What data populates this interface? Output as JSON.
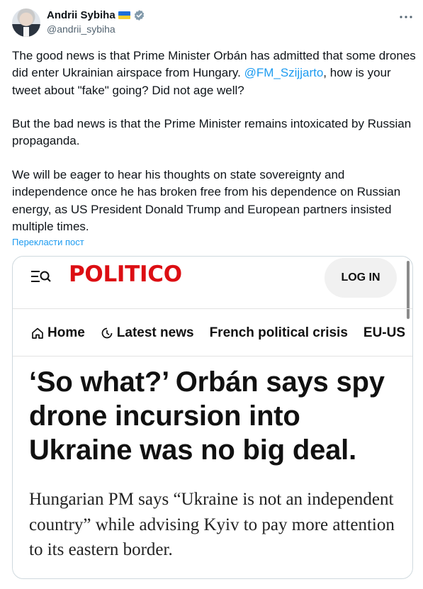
{
  "tweet": {
    "author_name": "Andrii Sybiha",
    "handle": "@andrii_sybiha",
    "paragraph1_before": "The good news is that Prime Minister Orbán has admitted that some drones did enter Ukrainian airspace from Hungary. ",
    "mention": "@FM_Szijjarto",
    "paragraph1_after": ", how is your tweet about \"fake\" going? Did not age well?",
    "paragraph2": "But the bad news is that the Prime Minister remains intoxicated by Russian propaganda.",
    "paragraph3": "We will be eager to hear his thoughts on state sovereignty and independence once he has broken free from his dependence on Russian energy, as US President Donald Trump and European partners insisted multiple times.",
    "translate_label": "Перекласти пост",
    "more_icon": "ellipsis-icon",
    "verified_icon": "verified-badge-icon",
    "flag": "ukraine-flag",
    "colors": {
      "link": "#1d9bf0",
      "text": "#0f1419",
      "muted": "#536471"
    }
  },
  "card": {
    "logo": "POLITICO",
    "login_label": "LOG IN",
    "nav": {
      "home": "Home",
      "latest": "Latest news",
      "french": "French political crisis",
      "eu_us": "EU-US"
    },
    "headline": "‘So what?’ Orbán says spy drone incursion into Ukraine was no big deal.",
    "dek": "Hungarian PM says “Ukraine is not an independent country” while advising Kyiv to pay more attention to its eastern border.",
    "colors": {
      "logo": "#dc0e13"
    }
  }
}
